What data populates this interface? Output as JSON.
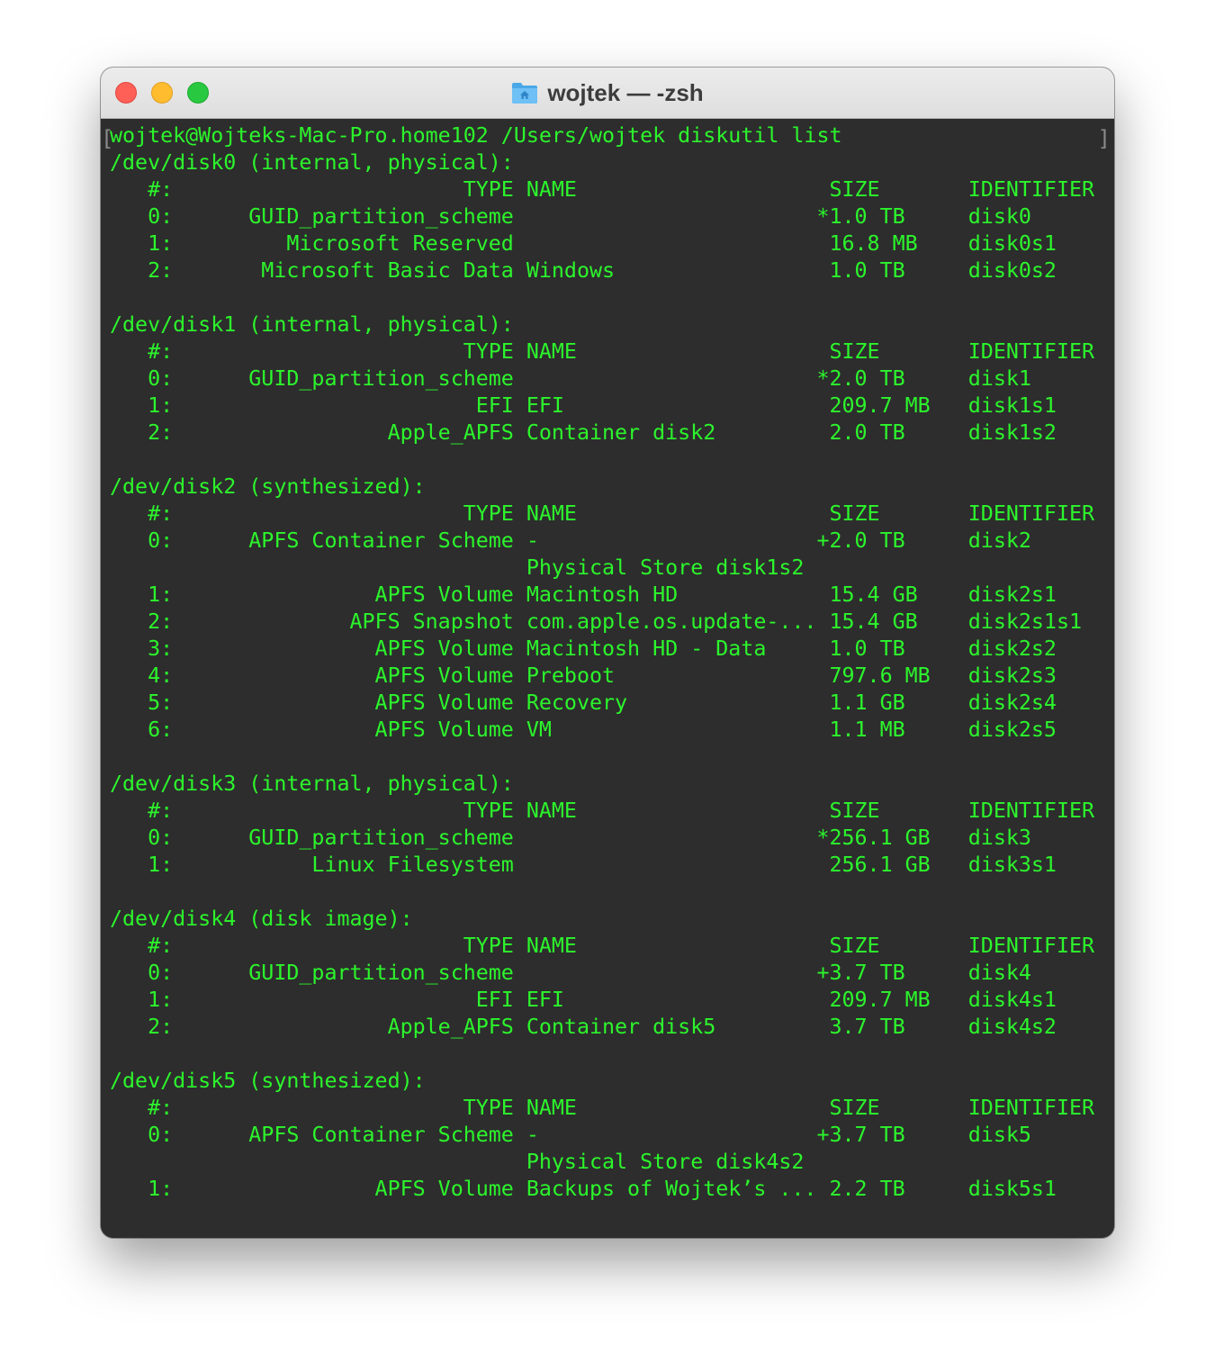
{
  "window": {
    "title": "wojtek — -zsh",
    "title_icon": "home-folder-icon"
  },
  "colors": {
    "terminal_background": "#2d2d2d",
    "terminal_text": "#2cf52c",
    "close": "#fe5f57",
    "minimize": "#febc2e",
    "zoom": "#28c840"
  },
  "terminal": {
    "bracket_left": "[",
    "bracket_right": "]",
    "lines": [
      "wojtek@Wojteks-Mac-Pro.home102 /Users/wojtek diskutil list",
      "/dev/disk0 (internal, physical):",
      "   #:                       TYPE NAME                    SIZE       IDENTIFIER",
      "   0:      GUID_partition_scheme                        *1.0 TB     disk0",
      "   1:         Microsoft Reserved                         16.8 MB    disk0s1",
      "   2:       Microsoft Basic Data Windows                 1.0 TB     disk0s2",
      "",
      "/dev/disk1 (internal, physical):",
      "   #:                       TYPE NAME                    SIZE       IDENTIFIER",
      "   0:      GUID_partition_scheme                        *2.0 TB     disk1",
      "   1:                        EFI EFI                     209.7 MB   disk1s1",
      "   2:                 Apple_APFS Container disk2         2.0 TB     disk1s2",
      "",
      "/dev/disk2 (synthesized):",
      "   #:                       TYPE NAME                    SIZE       IDENTIFIER",
      "   0:      APFS Container Scheme -                      +2.0 TB     disk2",
      "                                 Physical Store disk1s2",
      "   1:                APFS Volume Macintosh HD            15.4 GB    disk2s1",
      "   2:              APFS Snapshot com.apple.os.update-... 15.4 GB    disk2s1s1",
      "   3:                APFS Volume Macintosh HD - Data     1.0 TB     disk2s2",
      "   4:                APFS Volume Preboot                 797.6 MB   disk2s3",
      "   5:                APFS Volume Recovery                1.1 GB     disk2s4",
      "   6:                APFS Volume VM                      1.1 MB     disk2s5",
      "",
      "/dev/disk3 (internal, physical):",
      "   #:                       TYPE NAME                    SIZE       IDENTIFIER",
      "   0:      GUID_partition_scheme                        *256.1 GB   disk3",
      "   1:           Linux Filesystem                         256.1 GB   disk3s1",
      "",
      "/dev/disk4 (disk image):",
      "   #:                       TYPE NAME                    SIZE       IDENTIFIER",
      "   0:      GUID_partition_scheme                        +3.7 TB     disk4",
      "   1:                        EFI EFI                     209.7 MB   disk4s1",
      "   2:                 Apple_APFS Container disk5         3.7 TB     disk4s2",
      "",
      "/dev/disk5 (synthesized):",
      "   #:                       TYPE NAME                    SIZE       IDENTIFIER",
      "   0:      APFS Container Scheme -                      +3.7 TB     disk5",
      "                                 Physical Store disk4s2",
      "   1:                APFS Volume Backups of Wojtek’s ... 2.2 TB     disk5s1"
    ]
  }
}
